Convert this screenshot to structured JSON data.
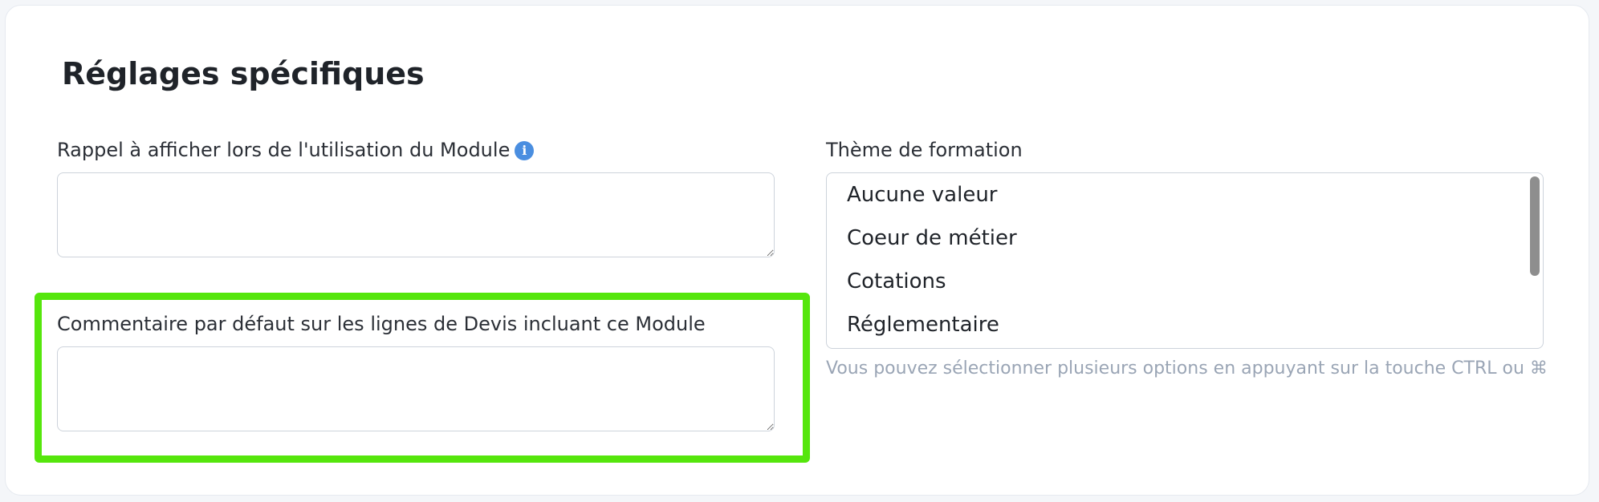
{
  "section": {
    "title": "Réglages spécifiques"
  },
  "reminder": {
    "label": "Rappel à afficher lors de l'utilisation du Module",
    "info_icon": "info-icon",
    "value": ""
  },
  "comment": {
    "label": "Commentaire par défaut sur les lignes de Devis incluant ce Module",
    "value": ""
  },
  "theme": {
    "label": "Thème de formation",
    "options": [
      "Aucune valeur",
      "Coeur de métier",
      "Cotations",
      "Réglementaire"
    ],
    "hint": "Vous pouvez sélectionner plusieurs options en appuyant sur la touche CTRL ou ⌘"
  },
  "colors": {
    "highlight": "#55e60c",
    "info_icon": "#4a8ee0",
    "hint_text": "#9aa5b5"
  }
}
